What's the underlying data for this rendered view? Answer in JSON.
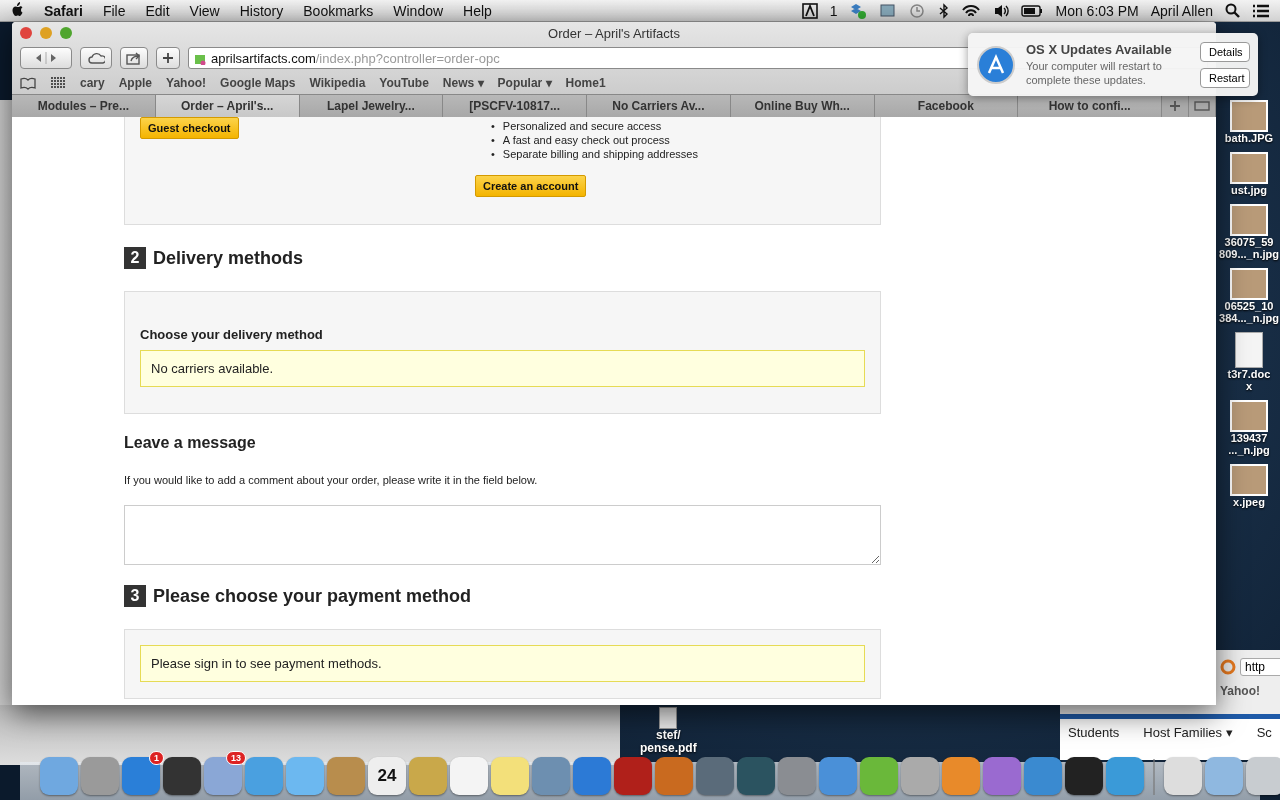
{
  "menu_bar": {
    "app": "Safari",
    "menus": [
      "File",
      "Edit",
      "View",
      "History",
      "Bookmarks",
      "Window",
      "Help"
    ],
    "adobe_count": "1",
    "clock": "Mon 6:03 PM",
    "user": "April Allen"
  },
  "browser": {
    "title": "Order – April's Artifacts",
    "url_host": "aprilsartifacts.com",
    "url_path": "/index.php?controller=order-opc",
    "bookmarks": [
      {
        "label": "cary"
      },
      {
        "label": "Apple"
      },
      {
        "label": "Yahoo!"
      },
      {
        "label": "Google Maps"
      },
      {
        "label": "Wikipedia"
      },
      {
        "label": "YouTube"
      },
      {
        "label": "News",
        "arrow": "▾"
      },
      {
        "label": "Popular",
        "arrow": "▾"
      },
      {
        "label": "Home1"
      }
    ],
    "tabs": [
      {
        "label": "Modules – Pre...",
        "selected": false
      },
      {
        "label": "Order – April's...",
        "selected": true
      },
      {
        "label": "Lapel Jewelry...",
        "selected": false
      },
      {
        "label": "[PSCFV-10817...",
        "selected": false
      },
      {
        "label": "No Carriers Av...",
        "selected": false
      },
      {
        "label": "Online Buy Wh...",
        "selected": false
      },
      {
        "label": "Facebook",
        "selected": false
      },
      {
        "label": "How to confi...",
        "selected": false
      }
    ]
  },
  "page": {
    "guest_button": "Guest checkout",
    "bullet": "•",
    "benefits": [
      "Personalized and secure access",
      "A fast and easy check out process",
      "Separate billing and shipping addresses"
    ],
    "create_button": "Create an account",
    "sections": [
      {
        "kind": "delivery",
        "number": "2",
        "title": "Delivery methods",
        "subtitle": "Choose your delivery method",
        "alert": "No carriers available."
      },
      {
        "kind": "message",
        "title": "Leave a message",
        "text": "If you would like to add a comment about your order, please write it in the field below."
      },
      {
        "kind": "payment",
        "number": "3",
        "title": "Please choose your payment method",
        "alert": "Please sign in to see payment methods."
      }
    ]
  },
  "notification": {
    "title": "OS X Updates Available",
    "body": "Your computer will restart to complete these updates.",
    "buttons": [
      "Details",
      "Restart"
    ]
  },
  "desktop_icons": [
    {
      "kind": "photo",
      "labels": [
        "bath.JPG"
      ]
    },
    {
      "kind": "photo",
      "labels": [
        "ust.jpg"
      ]
    },
    {
      "kind": "photo",
      "labels": [
        "36075_59",
        "809..._n.jpg"
      ]
    },
    {
      "kind": "photo",
      "labels": [
        "06525_10",
        "384..._n.jpg"
      ]
    },
    {
      "kind": "document",
      "labels": [
        "t3r7.doc",
        "x"
      ]
    },
    {
      "kind": "photo",
      "labels": [
        "139437",
        "..._n.jpg"
      ]
    },
    {
      "kind": "photo",
      "labels": [
        "x.jpeg"
      ]
    }
  ],
  "desktop_file": {
    "labels": [
      "stef/",
      "pense.pdf"
    ]
  },
  "back_window": {
    "url": "http",
    "bookmark": "Yahoo!",
    "nav": [
      {
        "label": "Students"
      },
      {
        "label": "Host Families",
        "arrow": "▾"
      },
      {
        "label": "Sc"
      }
    ]
  },
  "dock": [
    {
      "kind": "finder"
    },
    {
      "kind": "rocket"
    },
    {
      "kind": "appstore",
      "badge": "1"
    },
    {
      "kind": "dial"
    },
    {
      "kind": "stamp",
      "badge": "13"
    },
    {
      "kind": "compass"
    },
    {
      "kind": "bubble"
    },
    {
      "kind": "book"
    },
    {
      "kind": "calendar",
      "text": "24"
    },
    {
      "kind": "star"
    },
    {
      "kind": "list"
    },
    {
      "kind": "note"
    },
    {
      "kind": "photos"
    },
    {
      "kind": "music"
    },
    {
      "kind": "curtain"
    },
    {
      "kind": "guitar"
    },
    {
      "kind": "camera"
    },
    {
      "kind": "clock"
    },
    {
      "kind": "gear"
    },
    {
      "kind": "word"
    },
    {
      "kind": "excel"
    },
    {
      "kind": "question"
    },
    {
      "kind": "pp"
    },
    {
      "kind": "entourage"
    },
    {
      "kind": "people"
    },
    {
      "kind": "printer"
    },
    {
      "kind": "tiles"
    },
    {
      "kind": "separator"
    },
    {
      "kind": "document"
    },
    {
      "kind": "folder"
    },
    {
      "kind": "trash"
    }
  ]
}
